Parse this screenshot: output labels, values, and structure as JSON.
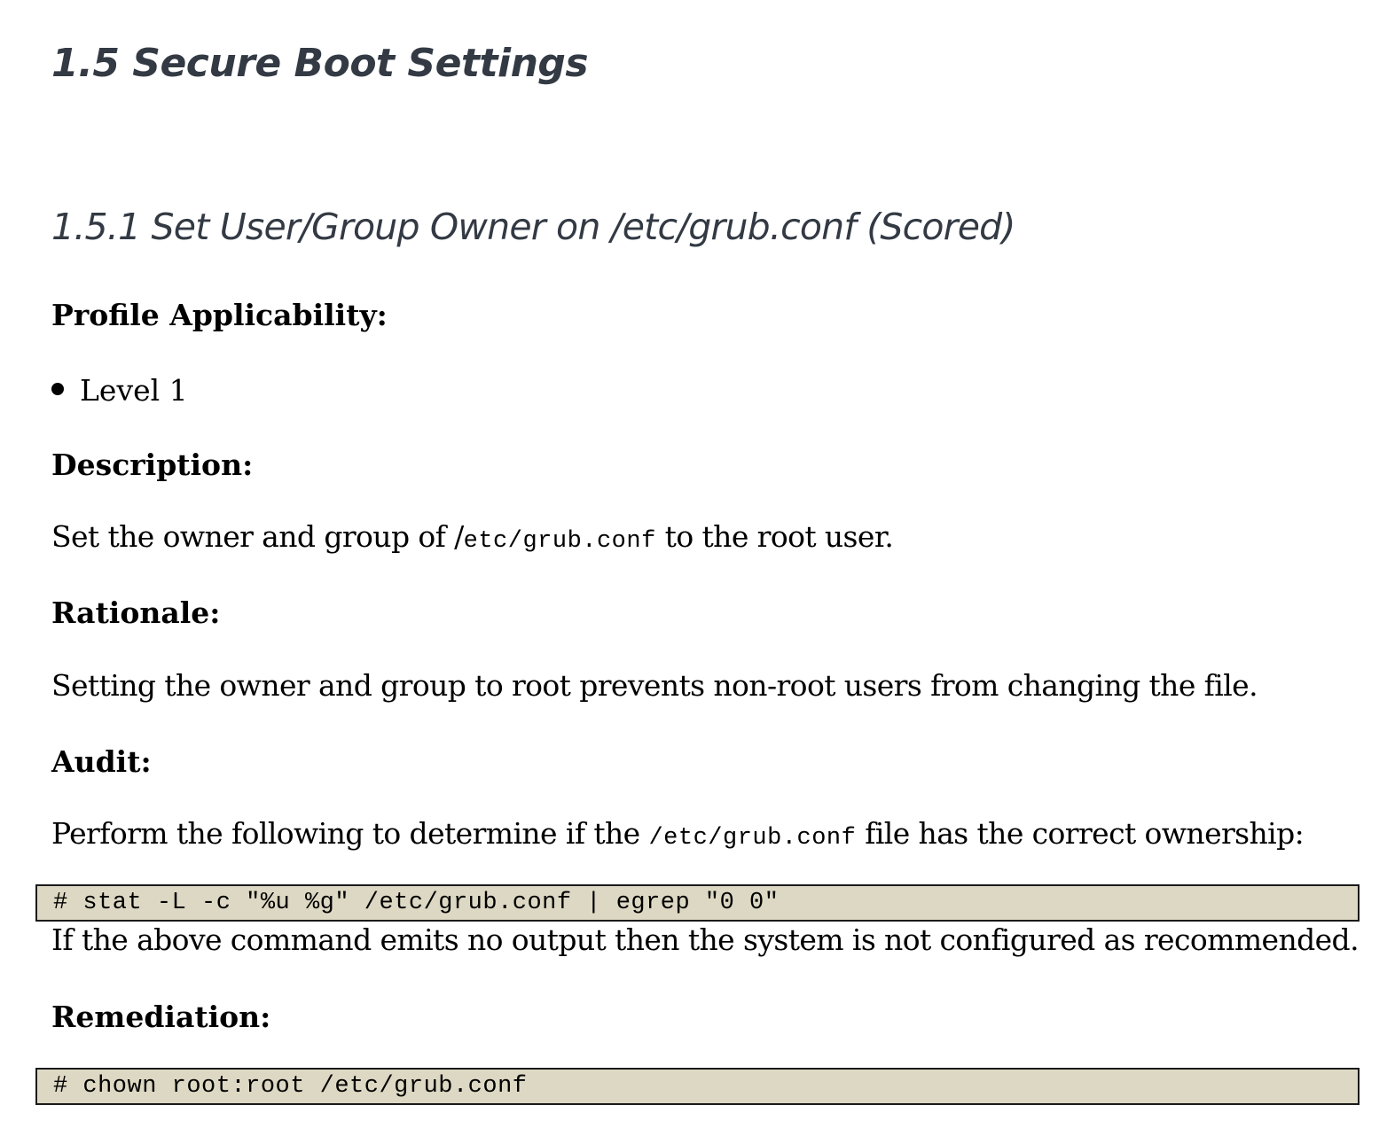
{
  "section": {
    "title": "1.5 Secure Boot Settings"
  },
  "subsection": {
    "title": "1.5.1 Set User/Group Owner on /etc/grub.conf (Scored)"
  },
  "profile": {
    "label": "Profile Applicability:",
    "items": [
      "Level 1"
    ]
  },
  "description": {
    "label": "Description:",
    "text_before": "Set the owner and group of /",
    "code": "etc/grub.conf",
    "text_after": " to the root user."
  },
  "rationale": {
    "label": "Rationale:",
    "text": "Setting the owner and group to root prevents non-root users from changing the file."
  },
  "audit": {
    "label": "Audit:",
    "text_before": "Perform the following to determine if the ",
    "code": "/etc/grub.conf",
    "text_after": " file has the correct ownership:",
    "command": "# stat -L -c \"%u %g\" /etc/grub.conf | egrep \"0 0\"",
    "note": "If the above command emits no output then the system is not configured as recommended."
  },
  "remediation": {
    "label": "Remediation:",
    "command": "# chown root:root /etc/grub.conf"
  },
  "colors": {
    "heading": "#333a44",
    "code_background": "#ddd8c3",
    "code_border": "#1a1a1a"
  }
}
